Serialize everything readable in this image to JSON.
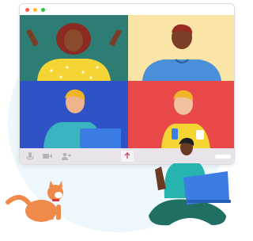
{
  "window": {
    "dots": [
      {
        "icon": "close-dot-icon",
        "color": "#ff5f57"
      },
      {
        "icon": "minimize-dot-icon",
        "color": "#febc2e"
      },
      {
        "icon": "maximize-dot-icon",
        "color": "#28c840"
      }
    ]
  },
  "participants": [
    {
      "name": "participant-top-left",
      "tile_color": "#2e7d75"
    },
    {
      "name": "participant-top-right",
      "tile_color": "#fbe5a6"
    },
    {
      "name": "participant-bottom-left",
      "tile_color": "#2f52c7"
    },
    {
      "name": "participant-bottom-right",
      "tile_color": "#e94848"
    }
  ],
  "controls": [
    {
      "name": "microphone-button",
      "icon": "microphone-icon"
    },
    {
      "name": "camera-button",
      "icon": "video-camera-icon"
    },
    {
      "name": "add-participant-button",
      "icon": "add-person-icon"
    },
    {
      "name": "share-screen-button",
      "icon": "share-upload-icon"
    },
    {
      "name": "more-options-button",
      "icon": "more-bar-icon"
    }
  ],
  "colors": {
    "controls_bar": "#e9e3ea",
    "control_icon": "#b9b0ba",
    "backdrop": "#eef7fb"
  }
}
